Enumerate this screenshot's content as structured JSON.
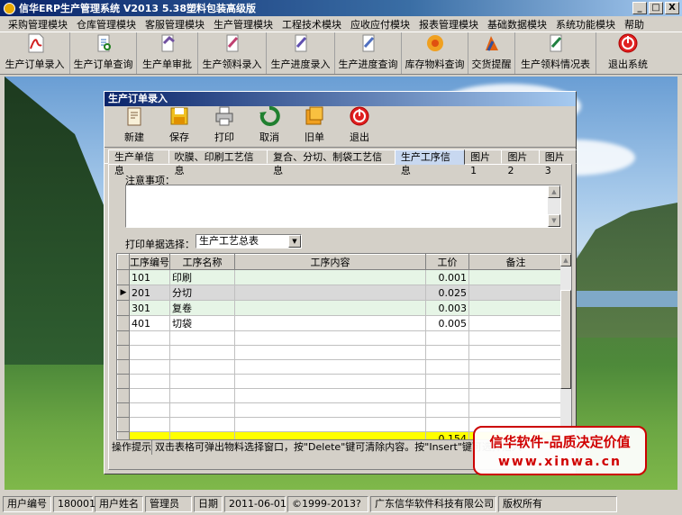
{
  "window": {
    "title": "信华ERP生产管理系统  V2013  5.38塑料包装高级版",
    "min_glyph": "_",
    "max_glyph": "□",
    "close_glyph": "X"
  },
  "menu": [
    "采购管理模块",
    "仓库管理模块",
    "客服管理模块",
    "生产管理模块",
    "工程技术模块",
    "应收应付模块",
    "报表管理模块",
    "基础数据模块",
    "系统功能模块",
    "帮助"
  ],
  "toolbar": [
    {
      "label": "生产订单录入",
      "icon": "pdf-doc-icon",
      "color": "#d02020"
    },
    {
      "label": "生产订单查询",
      "icon": "doc-query-icon",
      "color": "#3070c0"
    },
    {
      "label": "生产单审批",
      "icon": "doc-approve-icon",
      "color": "#7050a0"
    },
    {
      "label": "生产领料录入",
      "icon": "doc-material-icon",
      "color": "#c04070"
    },
    {
      "label": "生产进度录入",
      "icon": "doc-progress-icon",
      "color": "#6050b0"
    },
    {
      "label": "生产进度查询",
      "icon": "doc-progress-query-icon",
      "color": "#5070c0"
    },
    {
      "label": "库存物料查询",
      "icon": "inventory-icon",
      "color": "#e07010"
    },
    {
      "label": "交货提醒",
      "icon": "delivery-alert-icon",
      "color": "#d05010"
    },
    {
      "label": "生产领料情况表",
      "icon": "material-report-icon",
      "color": "#4060a0"
    },
    {
      "label": "退出系统",
      "icon": "exit-icon",
      "color": "#d02020"
    }
  ],
  "child": {
    "title": "生产订单录入",
    "toolbar": [
      {
        "label": "新建",
        "icon": "new-doc-icon"
      },
      {
        "label": "保存",
        "icon": "save-icon"
      },
      {
        "label": "打印",
        "icon": "printer-icon"
      },
      {
        "label": "取消",
        "icon": "cancel-icon"
      },
      {
        "label": "旧单",
        "icon": "old-order-icon"
      },
      {
        "label": "退出",
        "icon": "exit-icon"
      }
    ],
    "tabs": [
      "生产单信息",
      "吹膜、印刷工艺信息",
      "复合、分切、制袋工艺信息",
      "生产工序信息",
      "图片1",
      "图片2",
      "图片3"
    ],
    "active_tab": 3,
    "note_label": "注意事项：",
    "note_value": "",
    "print_label": "打印单据选择：",
    "print_value": "生产工艺总表",
    "grid": {
      "columns": [
        "工序编号",
        "工序名称",
        "工序内容",
        "工价",
        "备注"
      ],
      "rows": [
        {
          "code": "101",
          "name": "印刷",
          "content": "",
          "price": "0.001",
          "remark": ""
        },
        {
          "code": "201",
          "name": "分切",
          "content": "",
          "price": "0.025",
          "remark": ""
        },
        {
          "code": "301",
          "name": "复卷",
          "content": "",
          "price": "0.003",
          "remark": ""
        },
        {
          "code": "401",
          "name": "切袋",
          "content": "",
          "price": "0.005",
          "remark": ""
        }
      ],
      "selected_row": 1,
      "total_price": "0.154"
    },
    "hint_label": "操作提示",
    "hint_text": "双击表格可弹出物料选择窗口，按\"Delete\"键可清除内容。按\"Insert\"键可选择插入"
  },
  "promo": {
    "line1": "信华软件-品质决定价值",
    "line2": "www.xinwa.cn"
  },
  "status": {
    "user_code_label": "用户编号",
    "user_code": "180001",
    "user_name_label": "用户姓名",
    "user_name": "管理员",
    "date_label": "日期",
    "date": "2011-06-01",
    "copyright": "©1999-2013?",
    "company": "广东信华软件科技有限公司",
    "rights": "版权所有"
  }
}
